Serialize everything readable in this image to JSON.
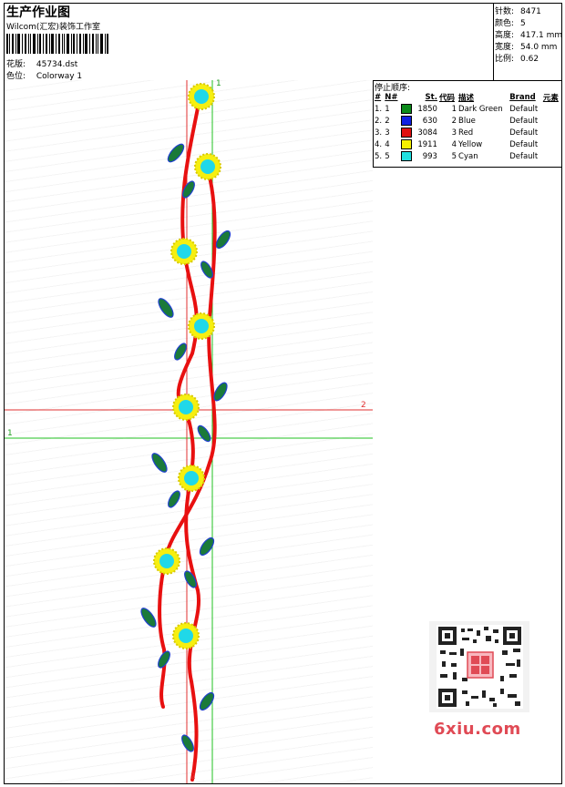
{
  "header": {
    "title": "生产作业图",
    "studio": "Wilcom(汇宏)装饰工作室",
    "design_label": "花版:",
    "design_value": "45734.dst",
    "colorway_label": "色位:",
    "colorway_value": "Colorway 1"
  },
  "stats": [
    {
      "label": "针数:",
      "value": "8471"
    },
    {
      "label": "颜色:",
      "value": "5"
    },
    {
      "label": "高度:",
      "value": "417.1 mm"
    },
    {
      "label": "宽度:",
      "value": "54.0 mm"
    },
    {
      "label": "比例:",
      "value": "0.62"
    }
  ],
  "stop_sequence": {
    "title": "停止顺序:",
    "columns": [
      "#",
      "N#",
      "St.",
      "代码",
      "描述",
      "Brand",
      "元素"
    ],
    "rows": [
      {
        "idx": "1.",
        "n": "1",
        "st": "1850",
        "code": "1",
        "desc": "Dark Green",
        "brand": "Default",
        "color": "#0b8a1a"
      },
      {
        "idx": "2.",
        "n": "2",
        "st": "630",
        "code": "2",
        "desc": "Blue",
        "brand": "Default",
        "color": "#1020e0"
      },
      {
        "idx": "3.",
        "n": "3",
        "st": "3084",
        "code": "3",
        "desc": "Red",
        "brand": "Default",
        "color": "#e01010"
      },
      {
        "idx": "4.",
        "n": "4",
        "st": "1911",
        "code": "4",
        "desc": "Yellow",
        "brand": "Default",
        "color": "#f5f000"
      },
      {
        "idx": "5.",
        "n": "5",
        "st": "993",
        "code": "5",
        "desc": "Cyan",
        "brand": "Default",
        "color": "#20e0e0"
      }
    ]
  },
  "guides": {
    "vertical_top_label": "1",
    "vertical_bottom_label": "2",
    "horizontal_red_label": "2",
    "horizontal_green_label": "1"
  },
  "watermark": {
    "text": "6xiu.com",
    "icon": "qr-code-icon"
  }
}
